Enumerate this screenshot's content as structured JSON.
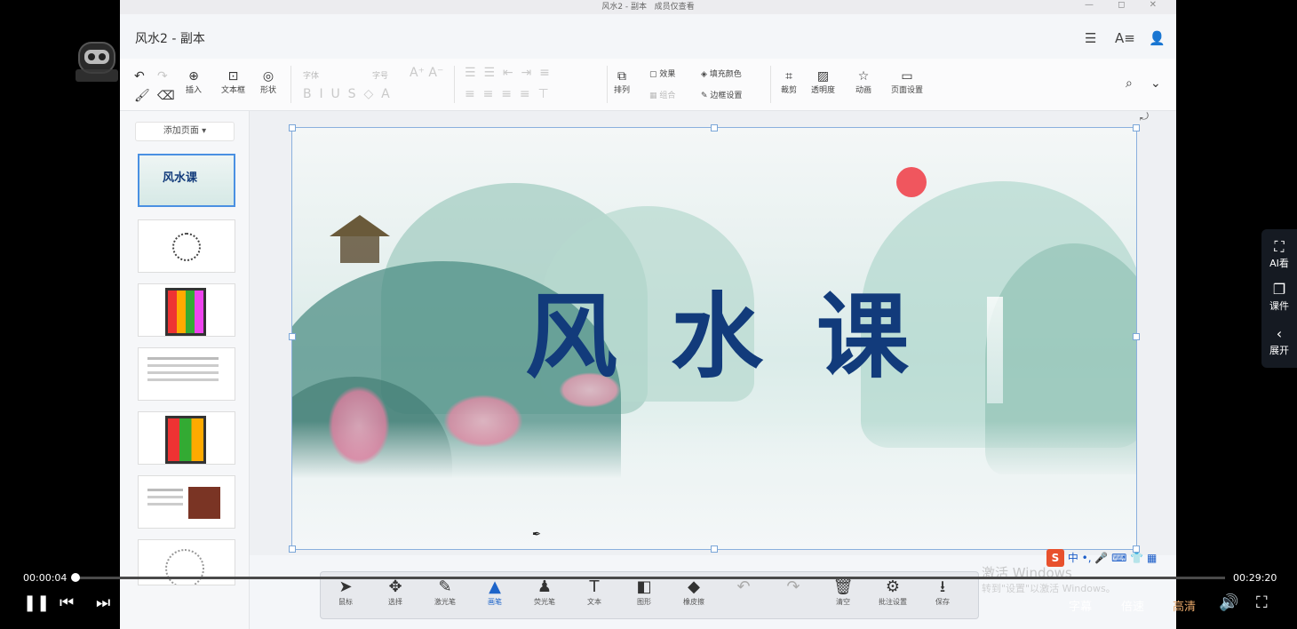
{
  "window": {
    "title_center": "风水2 - 副本",
    "mode": "成员仅查看",
    "controls": "— ◻ ✕"
  },
  "doc": {
    "title": "风水2 - 副本"
  },
  "toolbar": {
    "insert": "插入",
    "textbox": "文本框",
    "shape": "形状",
    "font": "字体",
    "size": "字号",
    "arrange": "排列",
    "effect": "效果",
    "combine": "组合",
    "fill": "填充颜色",
    "border": "边框设置",
    "crop": "裁剪",
    "transparency": "透明度",
    "animation": "动画",
    "page_setup": "页面设置"
  },
  "panel": {
    "add_page": "添加页面"
  },
  "slide": {
    "title": "风水课",
    "title_color": "#123b7b",
    "sun_color": "#f0565e"
  },
  "draw_tools": [
    {
      "label": "鼠标",
      "icon": "pointer-icon",
      "glyph": "➤",
      "state": "normal"
    },
    {
      "label": "选择",
      "icon": "move-icon",
      "glyph": "✥",
      "state": "normal"
    },
    {
      "label": "激光笔",
      "icon": "laser-pen-icon",
      "glyph": "✎",
      "state": "normal"
    },
    {
      "label": "画笔",
      "icon": "brush-icon",
      "glyph": "▲",
      "state": "active"
    },
    {
      "label": "荧光笔",
      "icon": "highlighter-icon",
      "glyph": "♟",
      "state": "normal"
    },
    {
      "label": "文本",
      "icon": "text-icon",
      "glyph": "T",
      "state": "normal"
    },
    {
      "label": "图形",
      "icon": "shape-icon",
      "glyph": "◧",
      "state": "normal"
    },
    {
      "label": "橡皮擦",
      "icon": "eraser-icon",
      "glyph": "◆",
      "state": "normal"
    },
    {
      "label": "",
      "icon": "undo-icon",
      "glyph": "↶",
      "state": "dim"
    },
    {
      "label": "",
      "icon": "redo-icon",
      "glyph": "↷",
      "state": "dim"
    },
    {
      "label": "清空",
      "icon": "trash-icon",
      "glyph": "🗑",
      "state": "normal"
    },
    {
      "label": "批注设置",
      "icon": "annotation-settings-icon",
      "glyph": "⚙",
      "state": "normal"
    },
    {
      "label": "保存",
      "icon": "download-icon",
      "glyph": "⭳",
      "state": "normal"
    }
  ],
  "ime": {
    "text": "中 •, 🎤 ⌨ 👕 ▦"
  },
  "watermark": {
    "line1": "激活 Windows",
    "line2": "转到\"设置\"以激活 Windows。"
  },
  "right_sidebar": {
    "ai": "AI看",
    "courseware": "课件",
    "expand": "展开"
  },
  "player": {
    "current_time": "00:00:04",
    "total_time": "00:29:20",
    "progress": 0.002,
    "subtitles": "字幕",
    "speed": "倍速",
    "quality": "高清",
    "quality_color": "#e8a86a"
  }
}
